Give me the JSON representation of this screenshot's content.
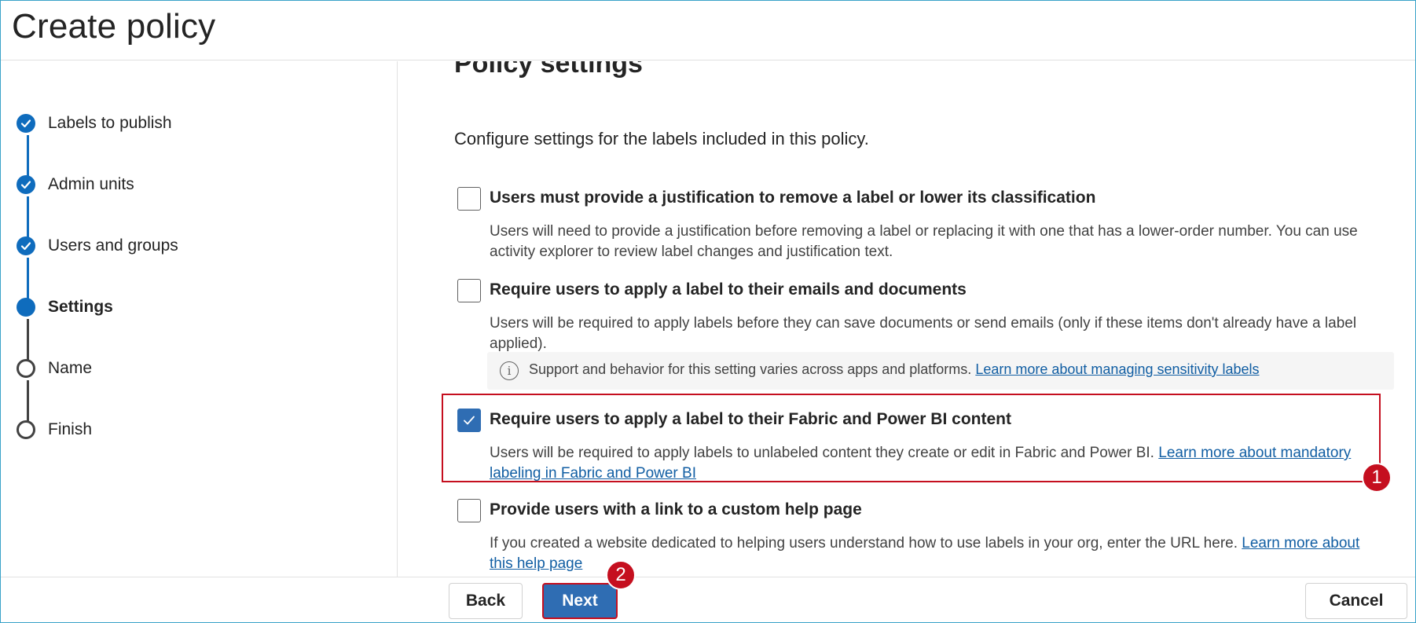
{
  "header": {
    "title": "Create policy"
  },
  "wizard": {
    "steps": [
      {
        "label": "Labels to publish",
        "state": "done"
      },
      {
        "label": "Admin units",
        "state": "done"
      },
      {
        "label": "Users and groups",
        "state": "done"
      },
      {
        "label": "Settings",
        "state": "current"
      },
      {
        "label": "Name",
        "state": "todo"
      },
      {
        "label": "Finish",
        "state": "todo"
      }
    ]
  },
  "main": {
    "title": "Policy settings",
    "intro": "Configure settings for the labels included in this policy.",
    "options": [
      {
        "title": "Users must provide a justification to remove a label or lower its classification",
        "description": "Users will need to provide a justification before removing a label or replacing it with one that has a lower-order number. You can use activity explorer to review label changes and justification text.",
        "checked": false
      },
      {
        "title": "Require users to apply a label to their emails and documents",
        "description": "Users will be required to apply labels before they can save documents or send emails (only if these items don't already have a label applied).",
        "checked": false,
        "info_text": "Support and behavior for this setting varies across apps and platforms.",
        "info_link": "Learn more about managing sensitivity labels"
      },
      {
        "title": "Require users to apply a label to their Fabric and Power BI content",
        "description": "Users will be required to apply labels to unlabeled content they create or edit in Fabric and Power BI.",
        "link": "Learn more about mandatory labeling in Fabric and Power BI",
        "checked": true
      },
      {
        "title": "Provide users with a link to a custom help page",
        "description": "If you created a website dedicated to helping users understand how to use labels in your org, enter the URL here.",
        "link": "Learn more about this help page",
        "checked": false
      }
    ]
  },
  "annotations": {
    "badge_1": "1",
    "badge_2": "2"
  },
  "footer": {
    "back_label": "Back",
    "next_label": "Next",
    "cancel_label": "Cancel"
  },
  "colors": {
    "accent": "#0f6cbd",
    "primary_button": "#2f6db3",
    "highlight": "#c50f1f"
  }
}
